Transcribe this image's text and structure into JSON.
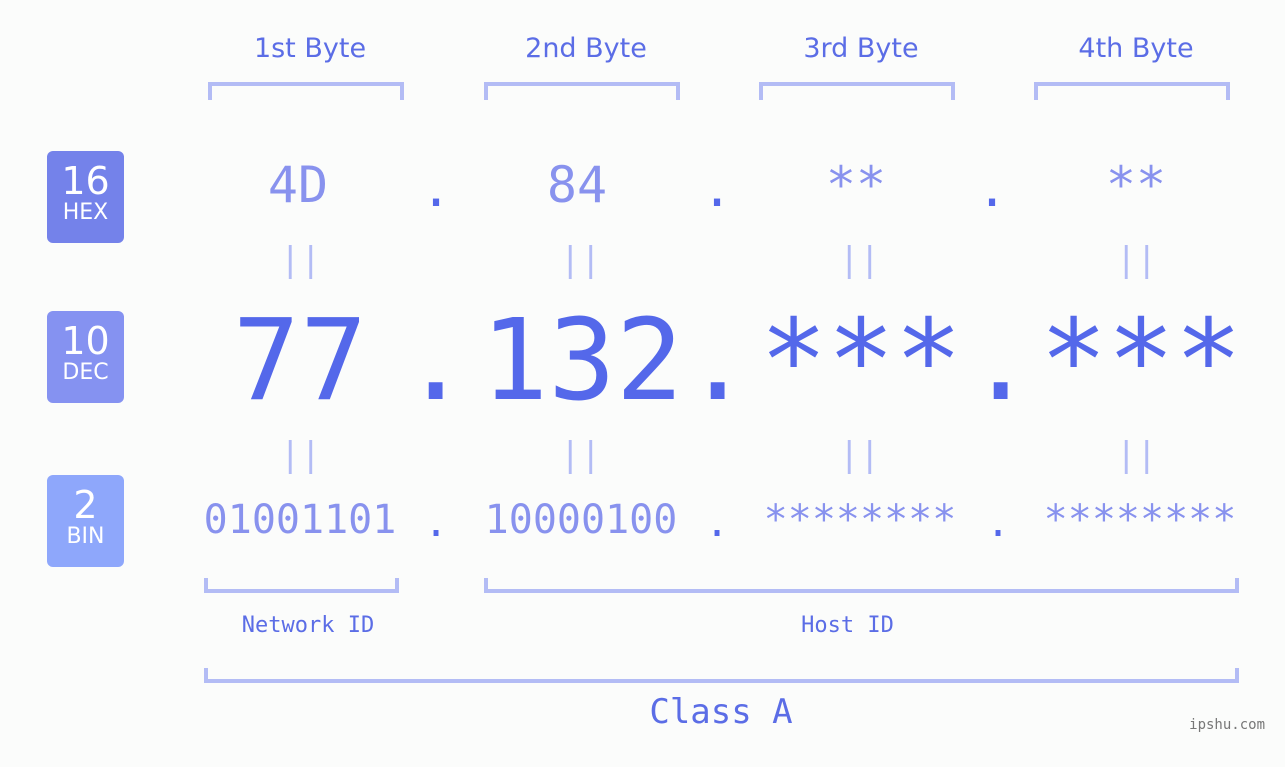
{
  "headers": [
    "1st Byte",
    "2nd Byte",
    "3rd Byte",
    "4th Byte"
  ],
  "badges": {
    "hex": {
      "num": "16",
      "label": "HEX",
      "color": "#7482ea"
    },
    "dec": {
      "num": "10",
      "label": "DEC",
      "color": "#8592f1"
    },
    "bin": {
      "num": "2",
      "label": "BIN",
      "color": "#8ea7fb"
    }
  },
  "hex": [
    "4D",
    "84",
    "**",
    "**"
  ],
  "dec": [
    "77",
    "132",
    "***",
    "***"
  ],
  "bin": [
    "01001101",
    "10000100",
    "********",
    "********"
  ],
  "separator": ".",
  "equals": "||",
  "network_label": "Network ID",
  "host_label": "Host ID",
  "class_label": "Class A",
  "watermark": "ipshu.com"
}
